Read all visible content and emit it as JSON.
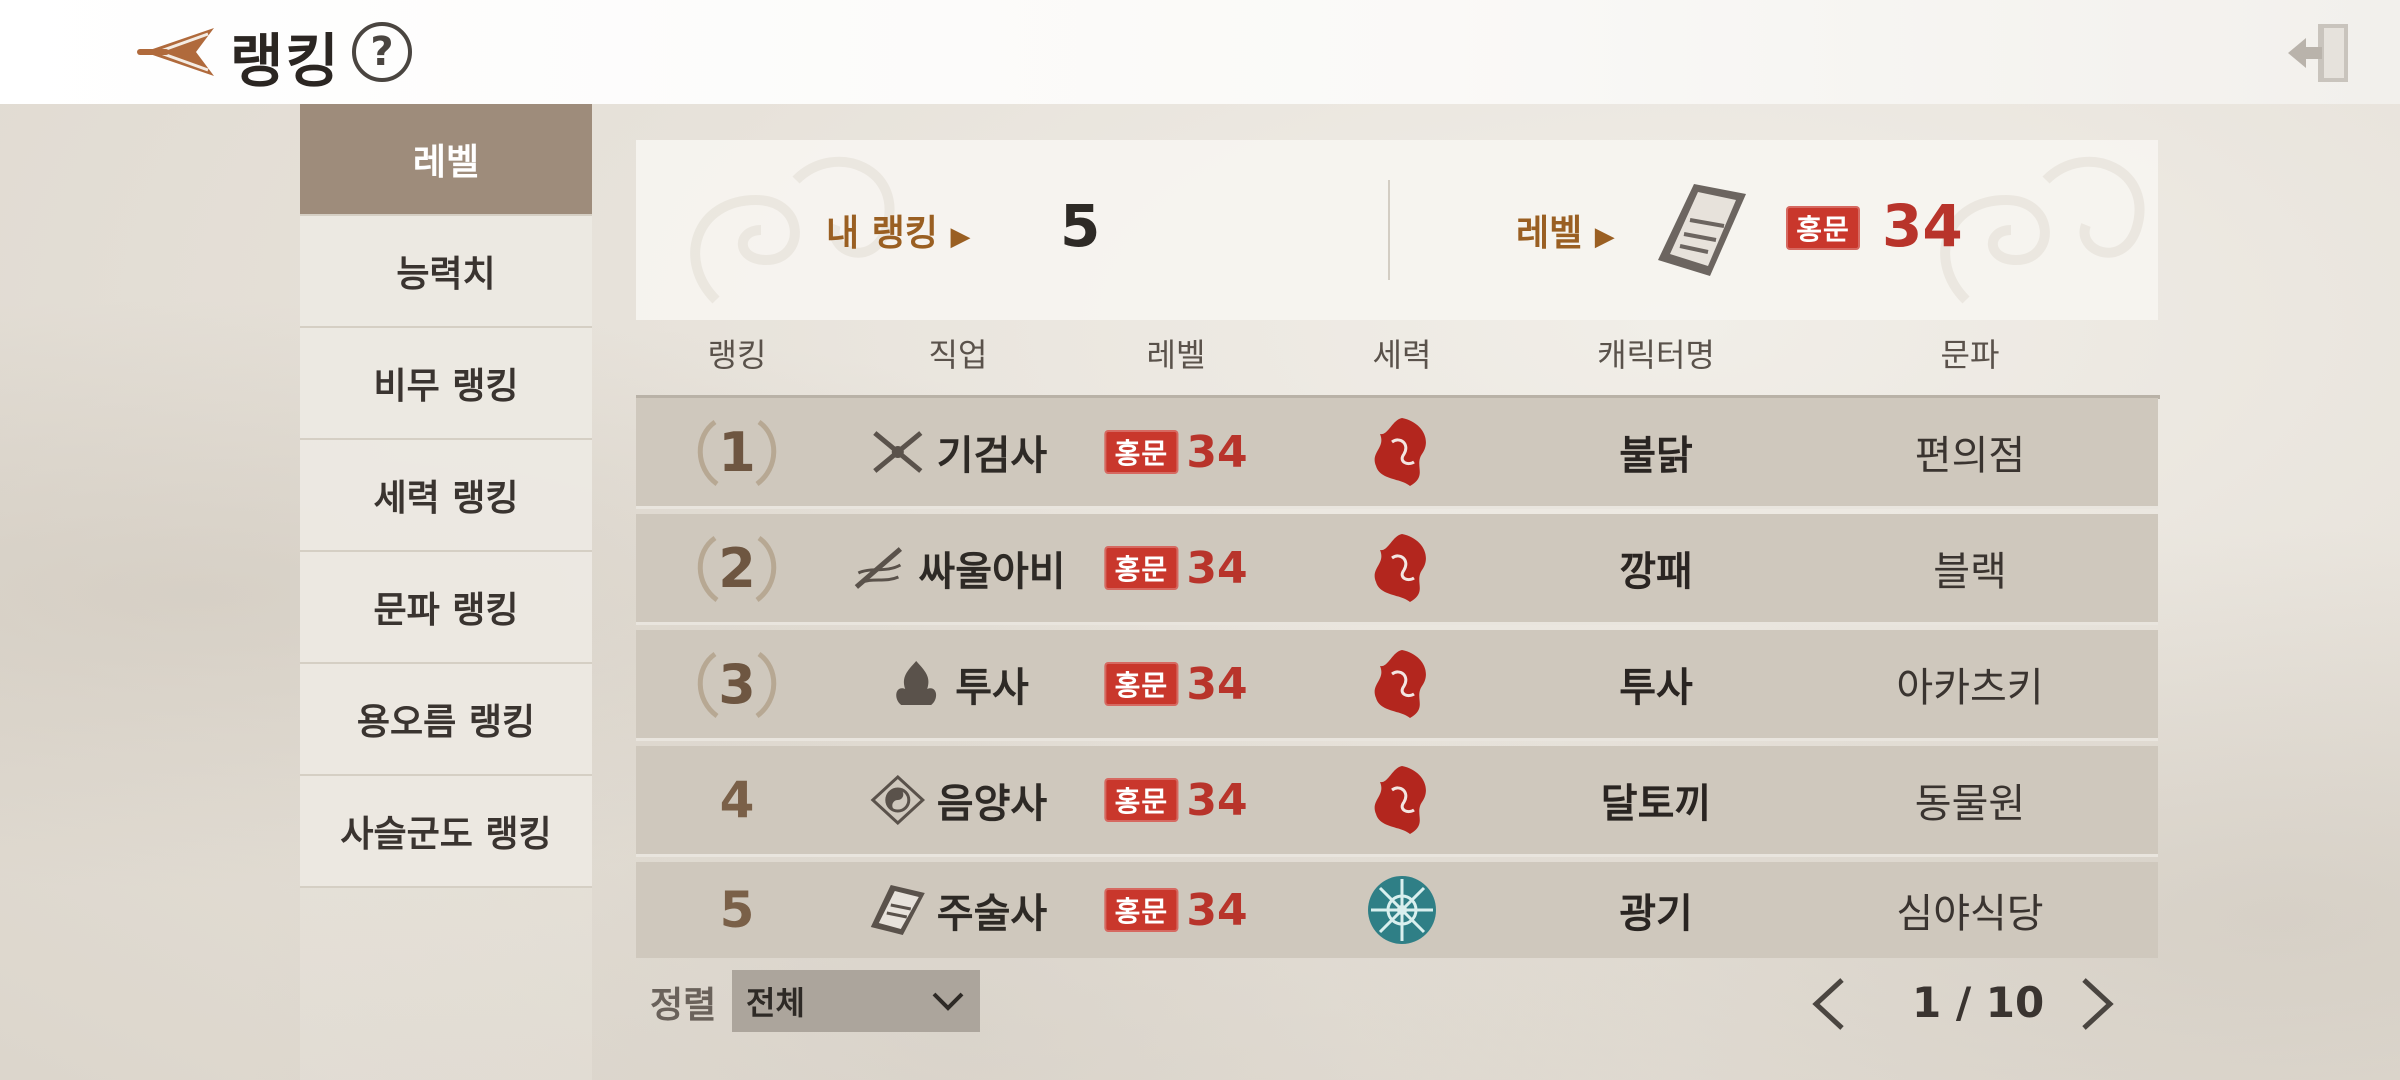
{
  "header": {
    "title": "랭킹",
    "help": "?"
  },
  "sidebar": {
    "items": [
      {
        "label": "레벨",
        "active": true
      },
      {
        "label": "능력치",
        "active": false
      },
      {
        "label": "비무 랭킹",
        "active": false
      },
      {
        "label": "세력 랭킹",
        "active": false
      },
      {
        "label": "문파 랭킹",
        "active": false
      },
      {
        "label": "용오름 랭킹",
        "active": false
      },
      {
        "label": "사슬군도 랭킹",
        "active": false
      }
    ]
  },
  "my_ranking": {
    "rank_label": "내 랭킹",
    "rank_value": "5",
    "level_label": "레벨",
    "level_badge": "홍문",
    "level_value": "34",
    "class_icon": "talisman-icon"
  },
  "table": {
    "headers": [
      "랭킹",
      "직업",
      "레벨",
      "세력",
      "캐릭터명",
      "문파"
    ],
    "rows": [
      {
        "rank": "1",
        "class_icon": "crossed-swords-icon",
        "class": "기검사",
        "badge": "홍문",
        "level": "34",
        "faction_icon": "red-phoenix-emblem-icon",
        "name": "불닭",
        "guild": "편의점"
      },
      {
        "rank": "2",
        "class_icon": "blade-dance-icon",
        "class": "싸울아비",
        "badge": "홍문",
        "level": "34",
        "faction_icon": "red-phoenix-emblem-icon",
        "name": "깡패",
        "guild": "블랙"
      },
      {
        "rank": "3",
        "class_icon": "fist-flame-icon",
        "class": "투사",
        "badge": "홍문",
        "level": "34",
        "faction_icon": "red-phoenix-emblem-icon",
        "name": "투사",
        "guild": "아카츠키"
      },
      {
        "rank": "4",
        "class_icon": "yin-yang-icon",
        "class": "음양사",
        "badge": "홍문",
        "level": "34",
        "faction_icon": "red-phoenix-emblem-icon",
        "name": "달토끼",
        "guild": "동물원"
      },
      {
        "rank": "5",
        "class_icon": "talisman-icon",
        "class": "주술사",
        "badge": "홍문",
        "level": "34",
        "faction_icon": "teal-snowflake-emblem-icon",
        "name": "광기",
        "guild": "심야식당"
      }
    ]
  },
  "footer": {
    "sort_label": "정렬",
    "sort_value": "전체",
    "page": "1 / 10"
  },
  "colors": {
    "accent_red": "#c9372c",
    "active_tab": "#9e8c7b",
    "label_brown": "#9a5f22",
    "faction_red": "#b3261e",
    "faction_teal": "#2f7f86"
  }
}
